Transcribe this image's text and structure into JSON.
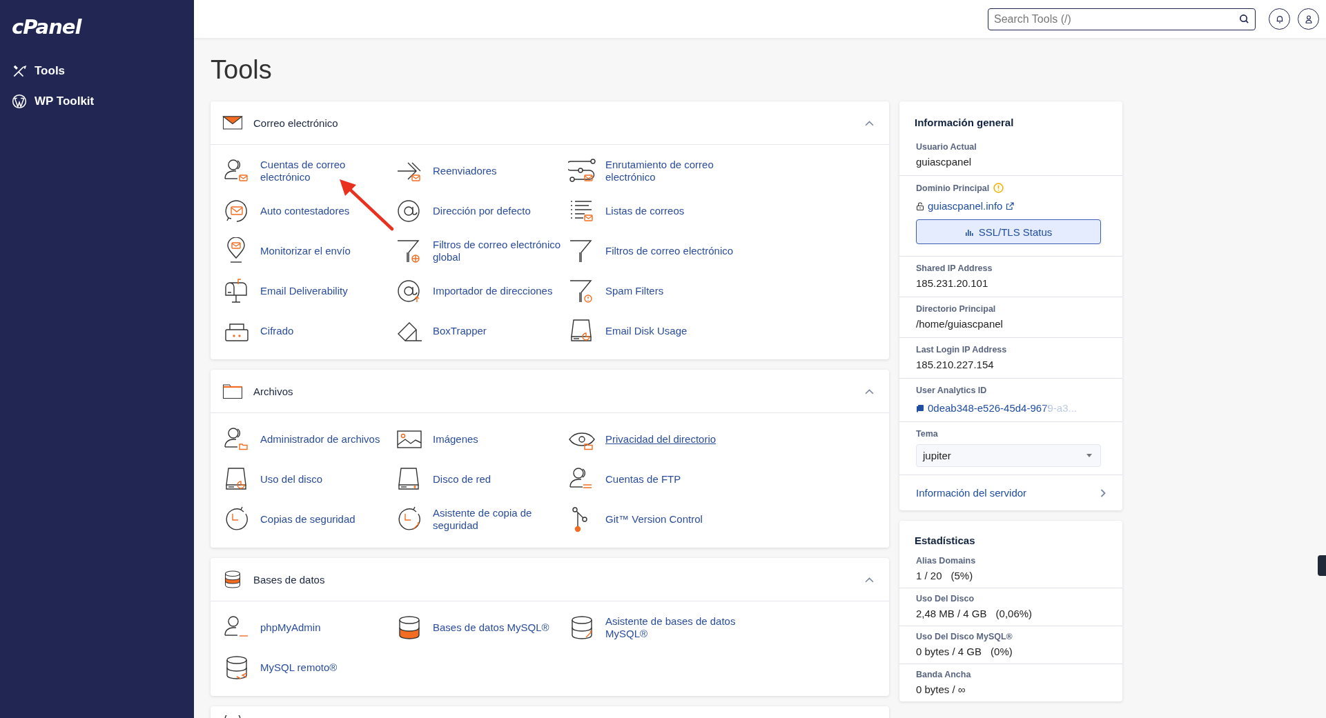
{
  "sidebar": {
    "logo": "cPanel",
    "items": [
      {
        "label": "Tools"
      },
      {
        "label": "WP Toolkit"
      }
    ]
  },
  "topbar": {
    "search": {
      "placeholder": "Search Tools (/)"
    }
  },
  "page_title": "Tools",
  "sections": [
    {
      "title": "Correo electrónico",
      "expanded": true,
      "items": [
        {
          "label": "Cuentas de correo electrónico",
          "hovered": false
        },
        {
          "label": "Reenviadores",
          "hovered": false
        },
        {
          "label": "Enrutamiento de correo electrónico",
          "hovered": false
        },
        {
          "label": "Auto contestadores",
          "hovered": false
        },
        {
          "label": "Dirección por defecto",
          "hovered": false
        },
        {
          "label": "Listas de correos",
          "hovered": false
        },
        {
          "label": "Monitorizar el envío",
          "hovered": false
        },
        {
          "label": "Filtros de correo electrónico global",
          "hovered": false
        },
        {
          "label": "Filtros de correo electrónico",
          "hovered": false
        },
        {
          "label": "Email Deliverability",
          "hovered": false
        },
        {
          "label": "Importador de direcciones",
          "hovered": false
        },
        {
          "label": "Spam Filters",
          "hovered": false
        },
        {
          "label": "Cifrado",
          "hovered": false
        },
        {
          "label": "BoxTrapper",
          "hovered": false
        },
        {
          "label": "Email Disk Usage",
          "hovered": false
        }
      ]
    },
    {
      "title": "Archivos",
      "expanded": true,
      "items": [
        {
          "label": "Administrador de archivos",
          "hovered": false
        },
        {
          "label": "Imágenes",
          "hovered": false
        },
        {
          "label": "Privacidad del directorio",
          "hovered": true
        },
        {
          "label": "Uso del disco",
          "hovered": false
        },
        {
          "label": "Disco de red",
          "hovered": false
        },
        {
          "label": "Cuentas de FTP",
          "hovered": false
        },
        {
          "label": "Copias de seguridad",
          "hovered": false
        },
        {
          "label": "Asistente de copia de seguridad",
          "hovered": false
        },
        {
          "label": "Git™ Version Control",
          "hovered": false
        }
      ]
    },
    {
      "title": "Bases de datos",
      "expanded": true,
      "items": [
        {
          "label": "phpMyAdmin",
          "hovered": false
        },
        {
          "label": "Bases de datos MySQL®",
          "hovered": false
        },
        {
          "label": "Asistente de bases de datos MySQL®",
          "hovered": false
        },
        {
          "label": "MySQL remoto®",
          "hovered": false
        }
      ]
    }
  ],
  "general_info": {
    "title": "Información general",
    "rows": [
      {
        "kind": "text",
        "label": "Usuario Actual",
        "value": "guiascpanel"
      },
      {
        "kind": "domain",
        "label": "Dominio Principal",
        "value": "guiascpanel.info",
        "button": "SSL/TLS Status"
      },
      {
        "kind": "text",
        "label": "Shared IP Address",
        "value": "185.231.20.101"
      },
      {
        "kind": "text",
        "label": "Directorio Principal",
        "value": "/home/guiascpanel"
      },
      {
        "kind": "text",
        "label": "Last Login IP Address",
        "value": "185.210.227.154"
      },
      {
        "kind": "copy",
        "label": "User Analytics ID",
        "value": "0deab348-e526-45d4-9679-a3..."
      },
      {
        "kind": "select",
        "label": "Tema",
        "value": "jupiter"
      },
      {
        "kind": "link",
        "value": "Información del servidor"
      }
    ]
  },
  "statistics": {
    "title": "Estadísticas",
    "rows": [
      {
        "label": "Alias Domains",
        "value": "1 / 20",
        "percent": "(5%)"
      },
      {
        "label": "Uso Del Disco",
        "value": "2,48 MB / 4 GB",
        "percent": "(0,06%)"
      },
      {
        "label": "Uso Del Disco MySQL®",
        "value": "0 bytes / 4 GB",
        "percent": "(0%)"
      },
      {
        "label": "Banda Ancha",
        "value": "0 bytes / ∞"
      }
    ]
  }
}
